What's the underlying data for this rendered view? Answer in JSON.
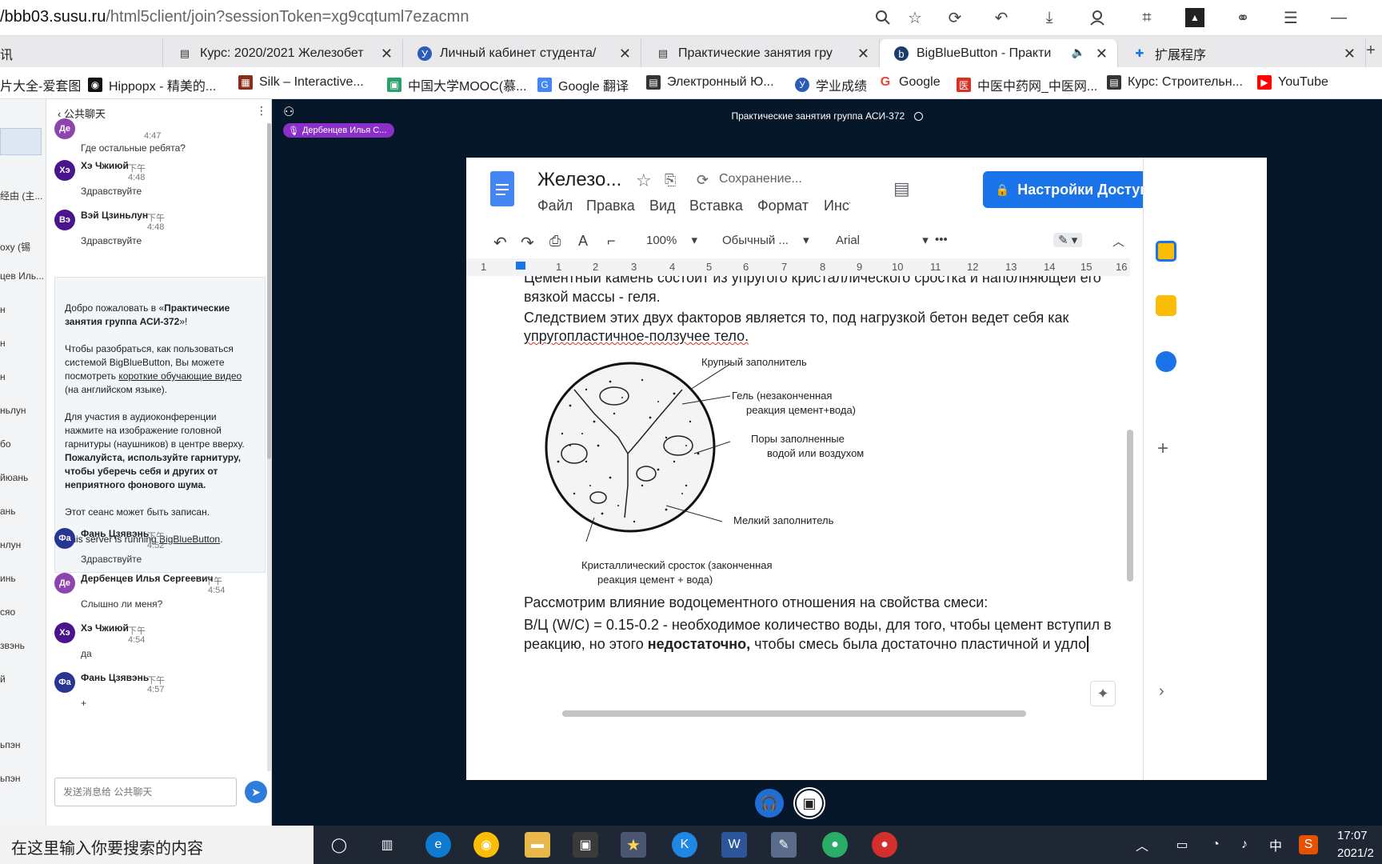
{
  "browser": {
    "url_host": "/bbb03.susu.ru",
    "url_rest": "/html5client/join?sessionToken=xg9cqtuml7ezacmn",
    "tabs": [
      {
        "label": "讯",
        "icon": "news-icon"
      },
      {
        "label": "Курс: 2020/2021 Железобет",
        "icon": "course-icon"
      },
      {
        "label": "Личный кабинет студента/",
        "icon": "university-icon"
      },
      {
        "label": "Практические занятия гру",
        "icon": "course-icon"
      },
      {
        "label": "BigBlueButton - Практи",
        "icon": "bbb-icon",
        "active": true
      },
      {
        "label": "扩展程序",
        "icon": "extension-icon"
      }
    ],
    "bookmarks": [
      {
        "label": "片大全-爱套图",
        "color": "#ffffff"
      },
      {
        "label": "Hippopx - 精美的...",
        "color": "#111111"
      },
      {
        "label": "Silk – Interactive...",
        "color": "#8b2d1a"
      },
      {
        "label": "中国大学MOOC(慕...",
        "color": "#2aa06b"
      },
      {
        "label": "Google 翻译",
        "color": "#4285f4"
      },
      {
        "label": "Электронный Ю...",
        "color": "#333333"
      },
      {
        "label": "学业成绩",
        "color": "#2b5cb8"
      },
      {
        "label": "Google",
        "color": "#ea4335"
      },
      {
        "label": "中医中药网_中医网...",
        "color": "#d93025"
      },
      {
        "label": "Курс: Строительн...",
        "color": "#333333"
      },
      {
        "label": "YouTube",
        "color": "#ff0000"
      }
    ]
  },
  "userlist": [
    "经由 (主...",
    "oxy (锡",
    "цев Иль...",
    "н",
    "н",
    "н",
    "ньлун",
    "бо",
    "йюань",
    "ань",
    "нлун",
    "инь",
    "сяо",
    "звэнь",
    "й",
    "ьпэн",
    "ьпэн"
  ],
  "chat": {
    "title": "公共聊天",
    "messages_top": [
      {
        "initials": "Де",
        "name": "",
        "time": "4:47",
        "text": "Где остальные ребята?",
        "color": "#8e44ad"
      },
      {
        "initials": "Хэ",
        "name": "Хэ Чжиюй",
        "ampm": "下午",
        "time": "4:48",
        "text": "Здравствуйте",
        "color": "#4a148c"
      },
      {
        "initials": "Вэ",
        "name": "Вэй Цзиньлун",
        "ampm": "下午",
        "time": "4:48",
        "text": "Здравствуйте",
        "color": "#4a148c"
      }
    ],
    "welcome": {
      "line1a": "Добро пожаловать в «",
      "line1b": "Практические занятия группа АСИ-372",
      "line1c": "»!",
      "p2a": "Чтобы разобраться, как пользоваться системой BigBlueButton, Вы можете посмотреть ",
      "p2link": "короткие обучающие видео",
      "p2b": " (на английском языке).",
      "p3a": "Для участия в аудиоконференции нажмите на изображение головной гарнитуры (наушников) в центре вверху. ",
      "p3b": "Пожалуйста, используйте гарнитуру, чтобы уберечь себя и других от неприятного фонового шума.",
      "p4": "Этот сеанс может быть записан.",
      "p5a": "This server is running ",
      "p5link": "BigBlueButton",
      "p5b": "."
    },
    "messages_bottom": [
      {
        "initials": "Фа",
        "name": "Фань Цзявэнь",
        "ampm": "下午",
        "time": "4:52",
        "text": "Здравствуйте",
        "color": "#283593"
      },
      {
        "initials": "Де",
        "name": "Дербенцев Илья Сергеевич",
        "ampm": "下午",
        "time": "4:54",
        "text": "Слышно ли меня?",
        "color": "#8e44ad"
      },
      {
        "initials": "Хэ",
        "name": "Хэ Чжиюй",
        "ampm": "下午",
        "time": "4:54",
        "text": "да",
        "color": "#4a148c"
      },
      {
        "initials": "Фа",
        "name": "Фань Цзявэнь",
        "ampm": "下午",
        "time": "4:57",
        "text": "+",
        "color": "#283593"
      }
    ],
    "input_placeholder": "发送消息给 公共聊天"
  },
  "presentation": {
    "title": "Практические занятия группа АСИ-372",
    "talker": "Дербенцев Илья С...",
    "doc": {
      "title": "Железо...",
      "saving": "Сохранение...",
      "menu": [
        "Файл",
        "Правка",
        "Вид",
        "Вставка",
        "Формат",
        "Инст"
      ],
      "access_button": "Настройки Доступа",
      "zoom": "100%",
      "style": "Обычный ...",
      "font": "Arial",
      "ruler": [
        "1",
        "1",
        "2",
        "3",
        "4",
        "5",
        "6",
        "7",
        "8",
        "9",
        "10",
        "11",
        "12",
        "13",
        "14",
        "15",
        "16"
      ],
      "para1": "Цементный камень состоит из упругого кристаллического сростка и наполняющей его",
      "para2": "вязкой массы - геля.",
      "para3": "Следствием этих двух факторов является то, под нагрузкой бетон ведет себя как",
      "para4": "упругопластичное-ползучее тело.",
      "labels": {
        "coarse": "Крупный заполнитель",
        "gel1": "Гель (незаконченная",
        "gel2": "реакция цемент+вода)",
        "pores1": "Поры заполненные",
        "pores2": "водой или воздухом",
        "fine": "Мелкий заполнитель",
        "crystal1": "Кристаллический сросток (законченная",
        "crystal2": "реакция цемент + вода)"
      },
      "para5": "Рассмотрим влияние водоцементного отношения на свойства смеси:",
      "para6": "В/Ц (W/C) = 0.15-0.2 - необходимое количество воды, для того, чтобы цемент вступил в",
      "para7a": "реакцию, но этого ",
      "para7b": "недостаточно,",
      "para7c": " чтобы смесь была достаточно пластичной и удло"
    }
  },
  "taskbar": {
    "search": "在这里输入你要搜索的内容",
    "tray_ime": "中",
    "time": "17:07",
    "date": "2021/2"
  }
}
